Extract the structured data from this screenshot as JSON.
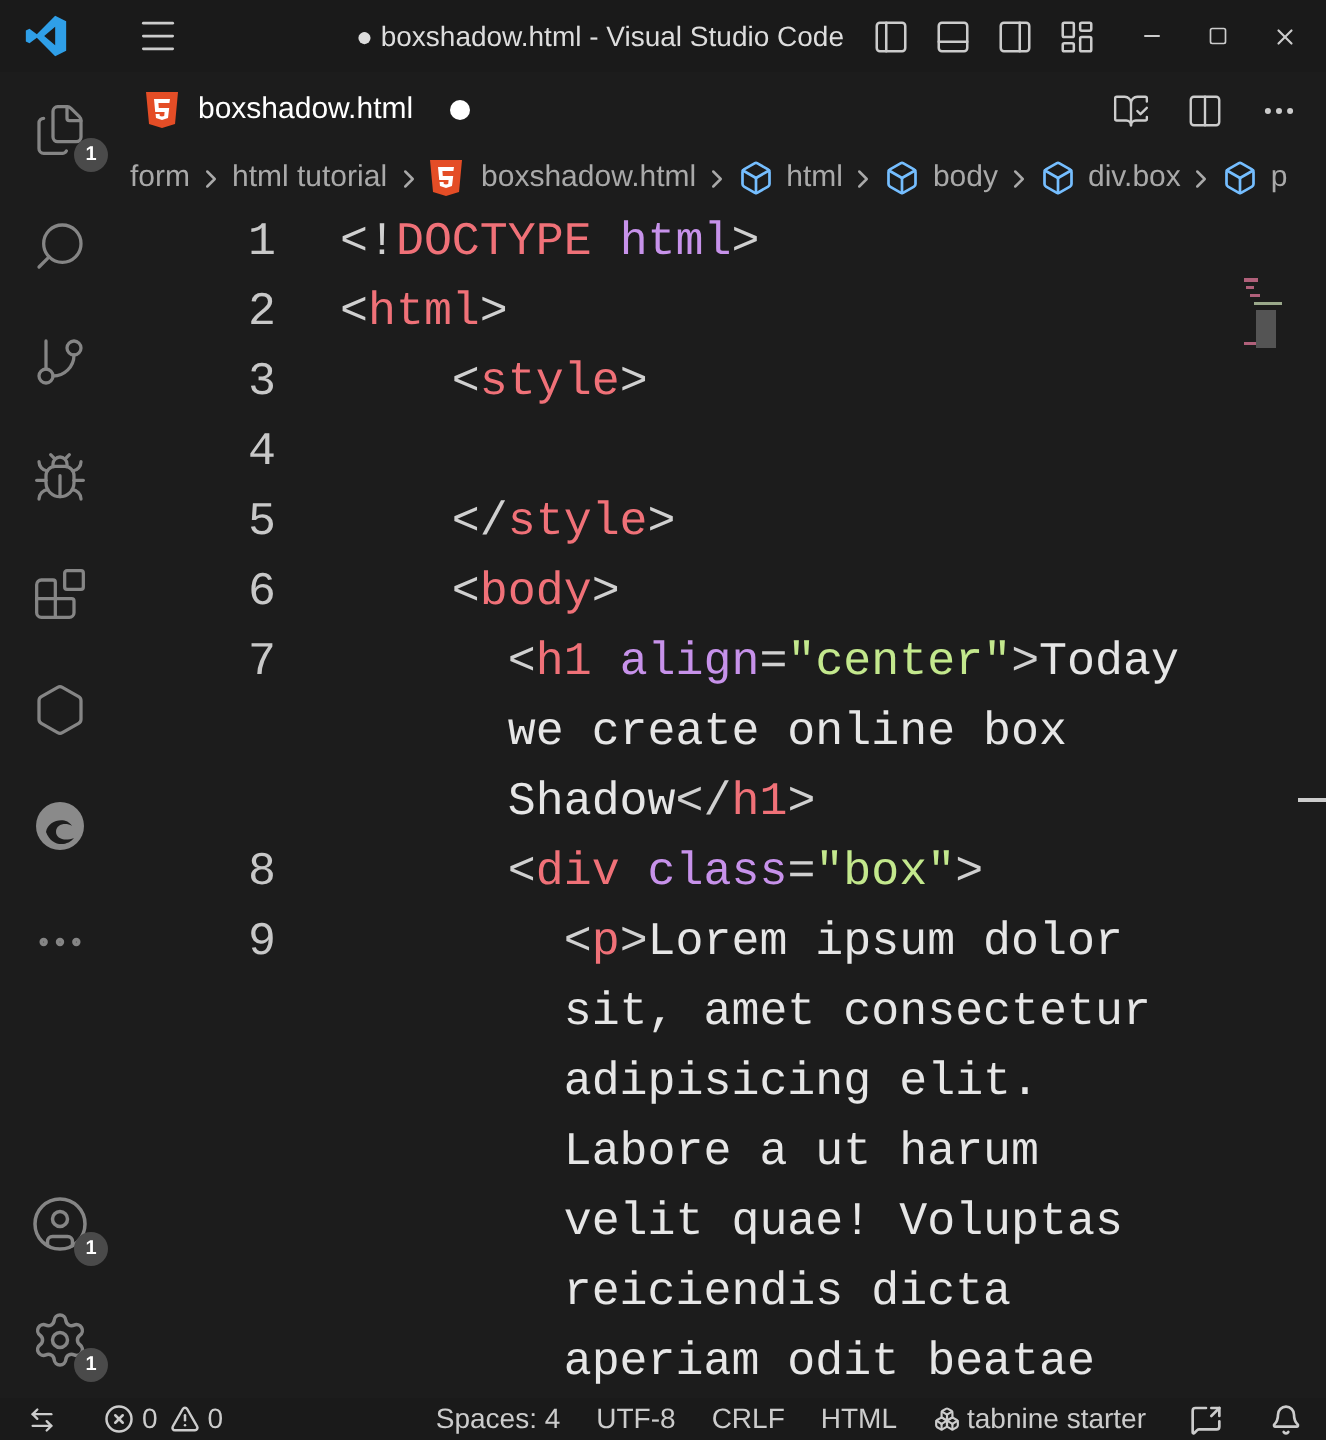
{
  "window": {
    "title": "● boxshadow.html - Visual Studio Code"
  },
  "activity_bar": {
    "items": [
      {
        "kind": "files",
        "badge": "1"
      },
      {
        "kind": "search"
      },
      {
        "kind": "source-control"
      },
      {
        "kind": "debug"
      },
      {
        "kind": "extensions"
      },
      {
        "kind": "hexagon"
      },
      {
        "kind": "swirl"
      },
      {
        "kind": "more"
      }
    ],
    "bottom": [
      {
        "kind": "account",
        "badge": "1"
      },
      {
        "kind": "settings",
        "badge": "1"
      }
    ]
  },
  "tabs": [
    {
      "label": "boxshadow.html",
      "selected": true,
      "modified": true
    }
  ],
  "breadcrumb": [
    {
      "kind": "folder",
      "label": "form"
    },
    {
      "kind": "folder",
      "label": "html tutorial"
    },
    {
      "kind": "file",
      "label": "boxshadow.html"
    },
    {
      "kind": "symbol",
      "label": "html"
    },
    {
      "kind": "symbol",
      "label": "body"
    },
    {
      "kind": "symbol",
      "label": "div.box"
    },
    {
      "kind": "symbol",
      "label": "p"
    }
  ],
  "editor": {
    "lines": [
      {
        "number": "1",
        "rows": [
          {
            "tokens": [
              {
                "kind": "punct",
                "text": "<!"
              },
              {
                "kind": "tag",
                "text": "DOCTYPE"
              },
              {
                "kind": "attr",
                "text": " html"
              },
              {
                "kind": "punct",
                "text": ">"
              }
            ]
          }
        ]
      },
      {
        "number": "2",
        "rows": [
          {
            "tokens": [
              {
                "kind": "punct",
                "text": "<"
              },
              {
                "kind": "tag",
                "text": "html"
              },
              {
                "kind": "punct",
                "text": ">"
              }
            ]
          }
        ]
      },
      {
        "number": "3",
        "rows": [
          {
            "tokens": [
              {
                "kind": "punct",
                "text": "    <"
              },
              {
                "kind": "tag",
                "text": "style"
              },
              {
                "kind": "punct",
                "text": ">"
              }
            ]
          }
        ]
      },
      {
        "number": "4",
        "rows": [
          {
            "tokens": []
          }
        ]
      },
      {
        "number": "5",
        "rows": [
          {
            "tokens": [
              {
                "kind": "punct",
                "text": "    </"
              },
              {
                "kind": "tag",
                "text": "style"
              },
              {
                "kind": "punct",
                "text": ">"
              }
            ]
          }
        ]
      },
      {
        "number": "6",
        "rows": [
          {
            "tokens": [
              {
                "kind": "punct",
                "text": "    <"
              },
              {
                "kind": "tag",
                "text": "body"
              },
              {
                "kind": "punct",
                "text": ">"
              }
            ]
          }
        ]
      },
      {
        "number": "7",
        "rows": [
          {
            "tokens": [
              {
                "kind": "punct",
                "text": "      <"
              },
              {
                "kind": "tag",
                "text": "h1"
              },
              {
                "kind": "attr",
                "text": " align"
              },
              {
                "kind": "punct",
                "text": "="
              },
              {
                "kind": "string",
                "text": "\"center\""
              },
              {
                "kind": "punct",
                "text": ">"
              },
              {
                "kind": "text",
                "text": "Today"
              }
            ]
          },
          {
            "tokens": [
              {
                "kind": "text",
                "text": "      we create online box"
              }
            ]
          },
          {
            "tokens": [
              {
                "kind": "text",
                "text": "      Shadow"
              },
              {
                "kind": "punct",
                "text": "</"
              },
              {
                "kind": "tag",
                "text": "h1"
              },
              {
                "kind": "punct",
                "text": ">"
              }
            ]
          }
        ]
      },
      {
        "number": "8",
        "rows": [
          {
            "tokens": [
              {
                "kind": "punct",
                "text": "      <"
              },
              {
                "kind": "tag",
                "text": "div"
              },
              {
                "kind": "attr",
                "text": " class"
              },
              {
                "kind": "punct",
                "text": "="
              },
              {
                "kind": "string",
                "text": "\"box\""
              },
              {
                "kind": "punct",
                "text": ">"
              }
            ]
          }
        ]
      },
      {
        "number": "9",
        "rows": [
          {
            "tokens": [
              {
                "kind": "punct",
                "text": "        <"
              },
              {
                "kind": "tag",
                "text": "p"
              },
              {
                "kind": "punct",
                "text": ">"
              },
              {
                "kind": "text",
                "text": "Lorem ipsum dolor"
              }
            ]
          },
          {
            "tokens": [
              {
                "kind": "text",
                "text": "        sit, amet consectetur"
              }
            ]
          },
          {
            "tokens": [
              {
                "kind": "text",
                "text": "        adipisicing elit."
              }
            ]
          },
          {
            "tokens": [
              {
                "kind": "text",
                "text": "        Labore a ut harum"
              }
            ]
          },
          {
            "tokens": [
              {
                "kind": "text",
                "text": "        velit quae! Voluptas"
              }
            ]
          },
          {
            "tokens": [
              {
                "kind": "text",
                "text": "        reiciendis dicta"
              }
            ]
          },
          {
            "tokens": [
              {
                "kind": "text",
                "text": "        aperiam odit beatae"
              }
            ]
          }
        ]
      }
    ]
  },
  "status_bar": {
    "errors": "0",
    "warnings": "0",
    "items": [
      "Spaces: 4",
      "UTF-8",
      "CRLF",
      "HTML"
    ],
    "tabnine": "tabnine starter"
  }
}
